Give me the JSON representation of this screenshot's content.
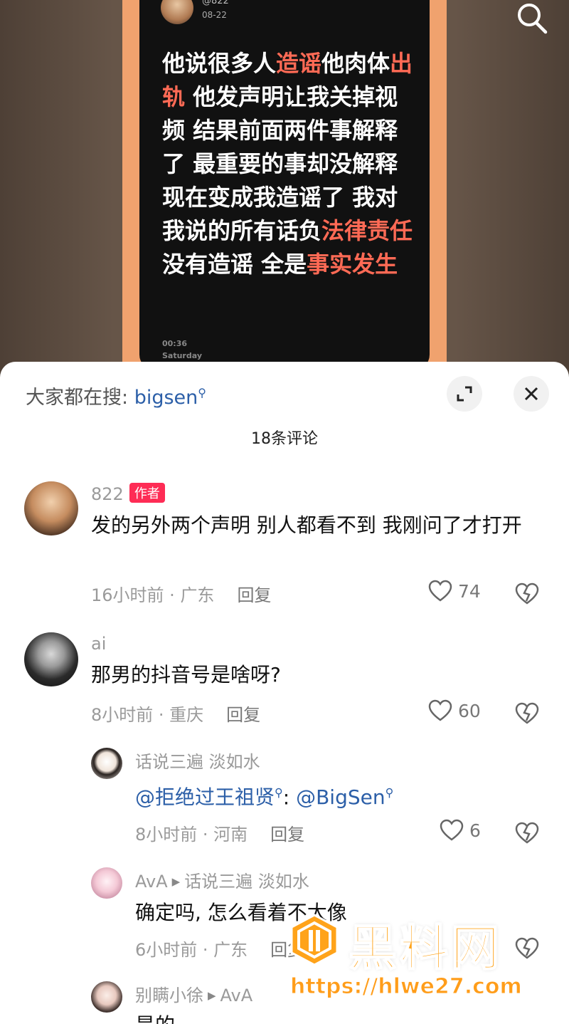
{
  "video": {
    "handle": "@822",
    "date": "08-22",
    "text_segments": [
      {
        "t": "他说很多人",
        "hl": false
      },
      {
        "t": "造谣",
        "hl": true
      },
      {
        "t": "他肉体",
        "hl": false
      },
      {
        "t": "出轨",
        "hl": true
      },
      {
        "t": " 他发声明让我关掉视频 结果前面两件事解释了 最重要的事却没解释 现在变成我造谣了 我对我说的所有话负",
        "hl": false
      },
      {
        "t": "法律责任",
        "hl": true
      },
      {
        "t": " 没有造谣 全是",
        "hl": false
      },
      {
        "t": "事实发生",
        "hl": true
      }
    ],
    "time": "00:36",
    "day": "Saturday",
    "highlight_color": "#ff6a55"
  },
  "sheet": {
    "trend_label": "大家都在搜:",
    "trend_term": "bigsen",
    "comment_count": "18条评论"
  },
  "comments": [
    {
      "name": "822",
      "author_tag": "作者",
      "text": "发的另外两个声明 别人都看不到 我刚问了才打开",
      "time": "16小时前",
      "location": "广东",
      "reply": "回复",
      "likes": "74"
    },
    {
      "name": "ai",
      "text": "那男的抖音号是啥呀?",
      "time": "8小时前",
      "location": "重庆",
      "reply": "回复",
      "likes": "60"
    }
  ],
  "replies": [
    {
      "name": "话说三遍 淡如水",
      "mention1": "@拒绝过王祖贤",
      "sep": ": ",
      "mention2": "@BigSen",
      "time": "8小时前",
      "location": "河南",
      "reply": "回复",
      "likes": "6"
    },
    {
      "name": "AvA",
      "reply_to": "话说三遍 淡如水",
      "text": "确定吗, 怎么看着不太像",
      "time": "6小时前",
      "location": "广东",
      "reply": "回复"
    },
    {
      "name": "别瞒小徐",
      "reply_to": "AvA",
      "text": "是的"
    }
  ],
  "watermark": {
    "title": "黑料网",
    "url": "https://hlwe27.com",
    "color": "#ffa31a"
  },
  "colors": {
    "author_tag": "#fe2c55",
    "link": "#2c5fa8"
  }
}
